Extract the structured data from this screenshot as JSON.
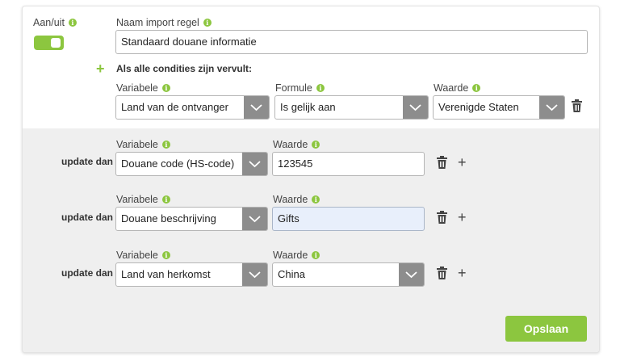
{
  "toggle": {
    "label": "Aan/uit",
    "state": "on"
  },
  "rule_name": {
    "label": "Naam import regel",
    "value": "Standaard douane informatie"
  },
  "conditions": {
    "heading": "Als alle condities zijn vervult:",
    "variabele_label": "Variabele",
    "formule_label": "Formule",
    "waarde_label": "Waarde",
    "variabele": "Land van de ontvanger",
    "formule": "Is gelijk aan",
    "waarde": "Verenigde Staten"
  },
  "actions": [
    {
      "prefix": "update dan",
      "variabele_label": "Variabele",
      "waarde_label": "Waarde",
      "variabele": "Douane code (HS-code)",
      "waarde": "123545"
    },
    {
      "prefix": "update dan",
      "variabele_label": "Variabele",
      "waarde_label": "Waarde",
      "variabele": "Douane beschrijving",
      "waarde": "Gifts"
    },
    {
      "prefix": "update dan",
      "variabele_label": "Variabele",
      "waarde_label": "Waarde",
      "variabele": "Land van herkomst",
      "waarde": "China"
    }
  ],
  "save_button": "Opslaan",
  "colors": {
    "accent": "#8cc63f",
    "arrow_bg": "#8d8d8d",
    "panel_bg": "#efefef"
  },
  "icons": {
    "info": "info-icon",
    "trash": "trash-icon",
    "plus": "plus-icon",
    "chevron": "chevron-down-icon"
  }
}
